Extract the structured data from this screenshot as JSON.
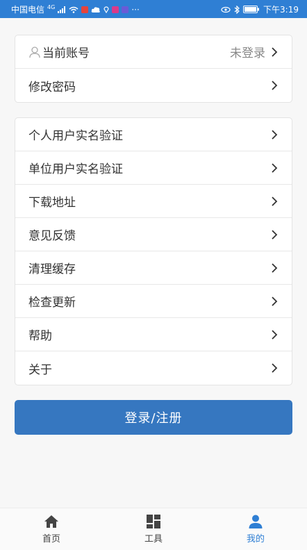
{
  "status_bar": {
    "carrier": "中国电信",
    "network": "4G",
    "time": "下午3:19",
    "extra": "···"
  },
  "account_card": {
    "rows": [
      {
        "label": "当前账号",
        "value": "未登录"
      },
      {
        "label": "修改密码"
      }
    ]
  },
  "menu_card": {
    "rows": [
      {
        "label": "个人用户实名验证"
      },
      {
        "label": "单位用户实名验证"
      },
      {
        "label": "下载地址"
      },
      {
        "label": "意见反馈"
      },
      {
        "label": "清理缓存"
      },
      {
        "label": "检查更新"
      },
      {
        "label": "帮助"
      },
      {
        "label": "关于"
      }
    ]
  },
  "login_button": "登录/注册",
  "tabbar": {
    "tabs": [
      {
        "label": "首页",
        "icon": "home-icon"
      },
      {
        "label": "工具",
        "icon": "grid-icon"
      },
      {
        "label": "我的",
        "icon": "person-icon"
      }
    ],
    "active": "我的"
  },
  "colors": {
    "accent": "#2f7fd4",
    "button": "#3677c0"
  }
}
